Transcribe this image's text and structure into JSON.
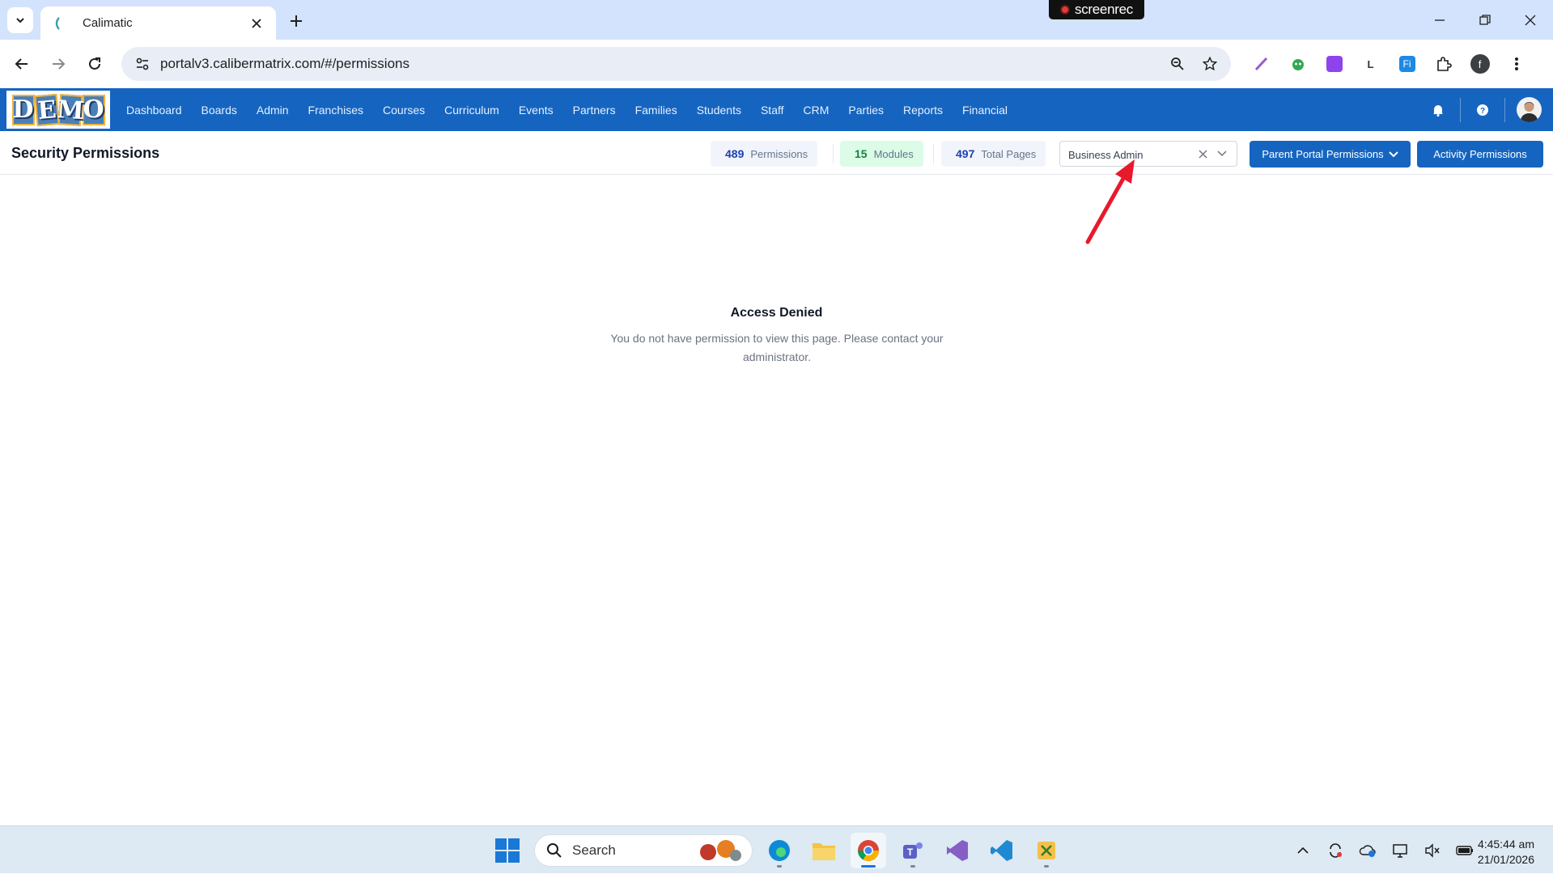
{
  "browser": {
    "tab_title": "Calimatic",
    "url": "portalv3.calibermatrix.com/#/permissions",
    "recorder_label": "screenrec",
    "profile_initial": "f"
  },
  "app": {
    "logo_letters": [
      "D",
      "E",
      "M",
      "O"
    ],
    "menu": [
      "Dashboard",
      "Boards",
      "Admin",
      "Franchises",
      "Courses",
      "Curriculum",
      "Events",
      "Partners",
      "Families",
      "Students",
      "Staff",
      "CRM",
      "Parties",
      "Reports",
      "Financial"
    ]
  },
  "page": {
    "title": "Security Permissions",
    "stats": {
      "permissions": {
        "value": "489",
        "label": "Permissions"
      },
      "modules": {
        "value": "15",
        "label": "Modules"
      },
      "total_pages": {
        "value": "497",
        "label": "Total Pages"
      }
    },
    "role_select": {
      "value": "Business Admin"
    },
    "buttons": {
      "parent_portal": "Parent Portal Permissions",
      "activity": "Activity Permissions"
    }
  },
  "content": {
    "denied_title": "Access Denied",
    "denied_message": "You do not have permission to view this page. Please contact your administrator."
  },
  "taskbar": {
    "search_placeholder": "Search",
    "time": "4:45:44 am",
    "date": "21/01/2026"
  },
  "colors": {
    "brand": "#1565c0",
    "annotation_arrow": "#e8192c"
  }
}
